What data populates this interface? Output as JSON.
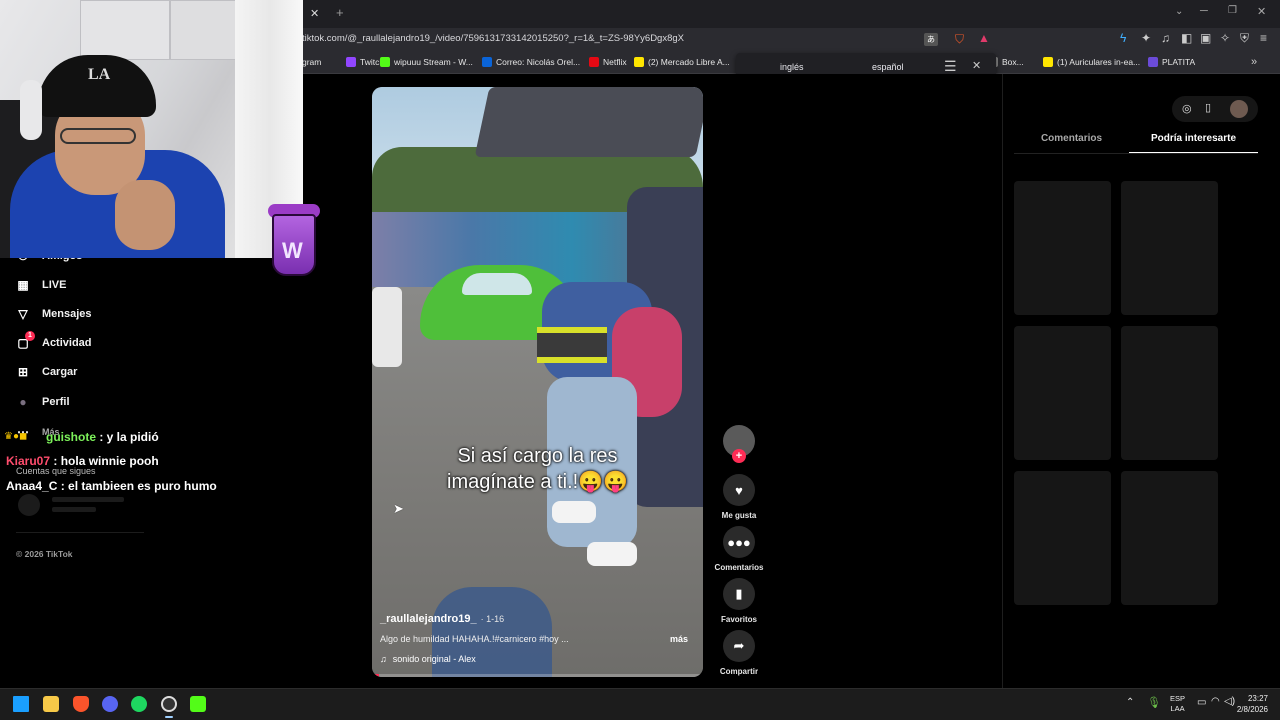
{
  "browser": {
    "url": "tiktok.com/@_raullalejandro19_/video/7596131733142015250?_r=1&_t=ZS-98Yy6Dgx8gX",
    "bookmarks": [
      {
        "label": "gram",
        "color": "#e1306c"
      },
      {
        "label": "Twitch",
        "color": "#9146ff"
      },
      {
        "label": "wipuuu Stream - W...",
        "color": "#53fc18"
      },
      {
        "label": "Correo: Nicolás Orel...",
        "color": "#0a64d8"
      },
      {
        "label": "Netflix",
        "color": "#e50914"
      },
      {
        "label": "(2) Mercado Libre A...",
        "color": "#ffe600"
      },
      {
        "label": "Box...",
        "color": "#888888"
      },
      {
        "label": "(1) Auriculares in-ea...",
        "color": "#ffe600"
      },
      {
        "label": "PLATITA",
        "color": "#6b4bd8"
      }
    ],
    "translate": {
      "source": "inglés",
      "target": "español"
    }
  },
  "sidebar": {
    "items": [
      {
        "label": "Amigos",
        "icon": "friends-icon"
      },
      {
        "label": "LIVE",
        "icon": "live-icon"
      },
      {
        "label": "Mensajes",
        "icon": "messages-icon"
      },
      {
        "label": "Actividad",
        "icon": "activity-icon",
        "badge": "1"
      },
      {
        "label": "Cargar",
        "icon": "upload-icon"
      },
      {
        "label": "Perfil",
        "icon": "profile-icon"
      },
      {
        "label": "Más",
        "icon": "more-icon"
      }
    ],
    "following_label": "Cuentas que sigues",
    "copyright": "© 2026 TikTok"
  },
  "chat": [
    {
      "user": "guishote",
      "message": " : y la pidió",
      "color": "#7cf05a"
    },
    {
      "user": "Kiaru07",
      "message": " : hola winnie pooh",
      "color": "#ff4d6d"
    },
    {
      "user": "Anaa4_C",
      "message": " : el tambieen es puro humo",
      "color": "#ffffff"
    }
  ],
  "video": {
    "caption_line1": "Si así cargo la res",
    "caption_line2": "imagínate a ti.!😛😛",
    "author": "_raullalejandro19_",
    "date": "· 1-16",
    "description": "Algo de humildad HAHAHA.!#carnicero #hoy ...",
    "more": "más",
    "sound": "sonido original - Alex"
  },
  "actions": {
    "like": "Me gusta",
    "comments": "Comentarios",
    "favorites": "Favoritos",
    "share": "Compartir"
  },
  "right_panel": {
    "tabs": [
      "Comentarios",
      "Podría interesarte"
    ],
    "active_tab": 1
  },
  "taskbar": {
    "lang_line1": "ESP",
    "lang_line2": "LAA",
    "time": "23:27",
    "date": "2/8/2026"
  }
}
